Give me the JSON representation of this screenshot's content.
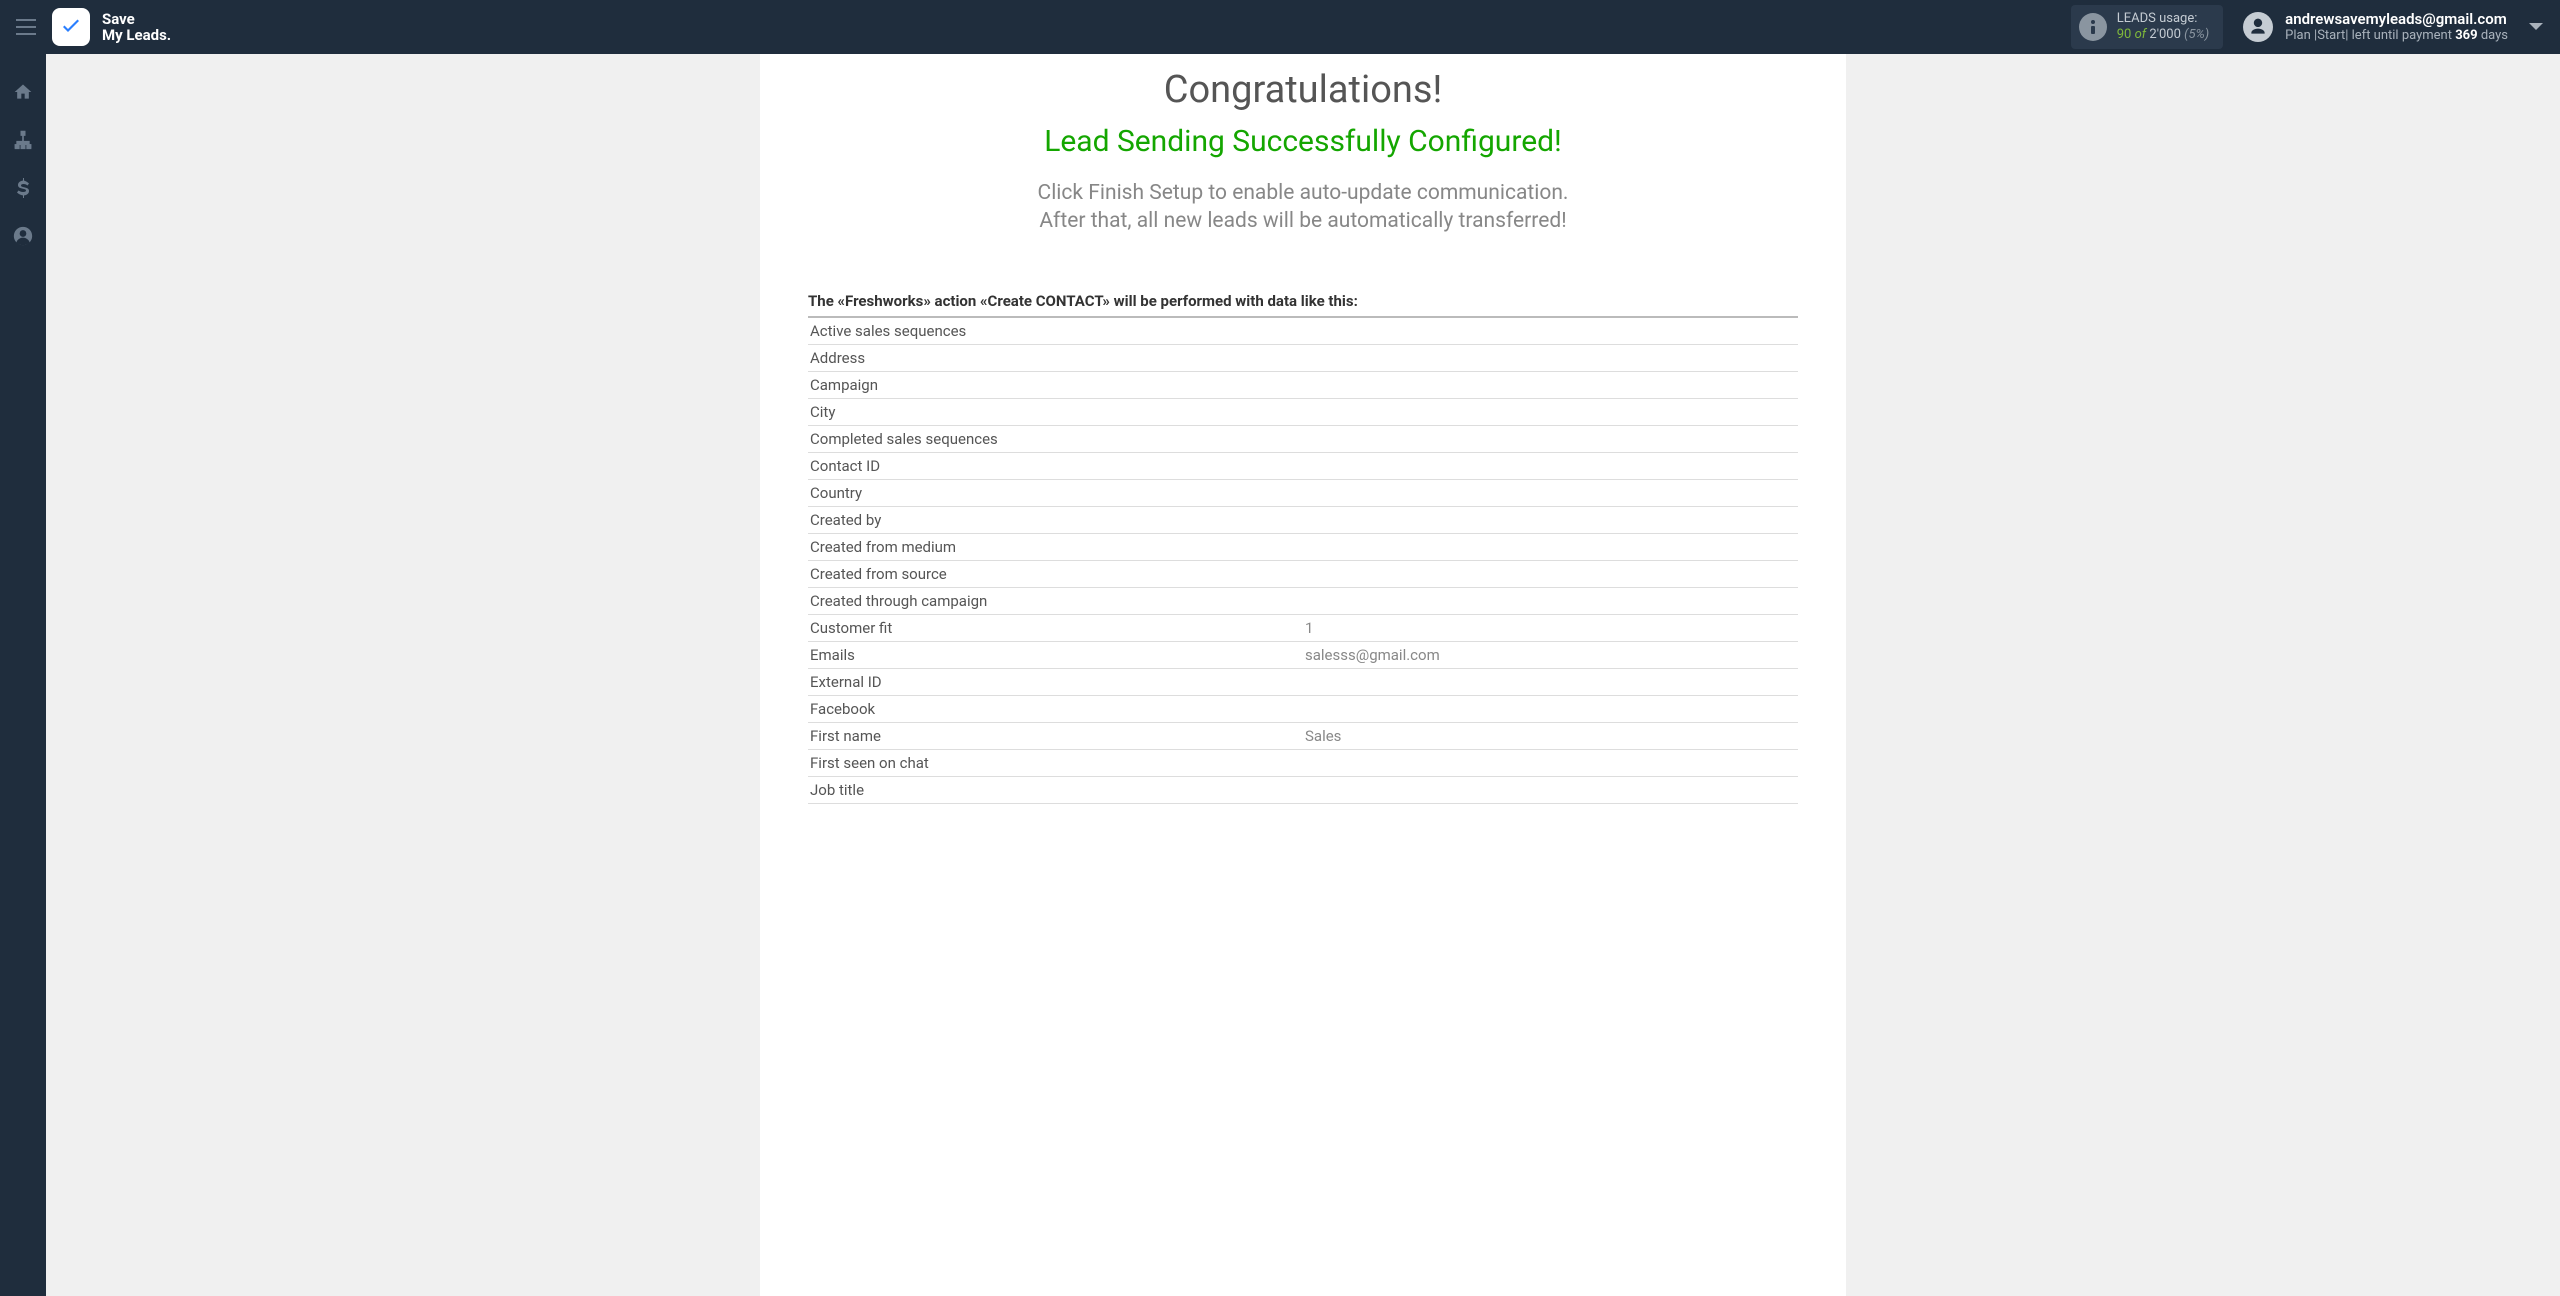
{
  "header": {
    "logo_line1": "Save",
    "logo_line2": "My Leads.",
    "usage": {
      "label": "LEADS usage:",
      "current": "90",
      "of": "of",
      "total": "2'000",
      "percent": "(5%)"
    },
    "account": {
      "email": "andrewsavemyleads@gmail.com",
      "plan_prefix": "Plan |",
      "plan_name": "Start",
      "plan_mid": "| left until payment ",
      "days_num": "369",
      "days_label": " days"
    }
  },
  "main": {
    "congrats": "Congratulations!",
    "success": "Lead Sending Successfully Configured!",
    "instructions_line1": "Click Finish Setup to enable auto-update communication.",
    "instructions_line2": "After that, all new leads will be automatically transferred!",
    "action_heading": "The «Freshworks» action «Create CONTACT» will be performed with data like this:",
    "rows": [
      {
        "label": "Active sales sequences",
        "value": ""
      },
      {
        "label": "Address",
        "value": ""
      },
      {
        "label": "Campaign",
        "value": ""
      },
      {
        "label": "City",
        "value": ""
      },
      {
        "label": "Completed sales sequences",
        "value": ""
      },
      {
        "label": "Contact ID",
        "value": ""
      },
      {
        "label": "Country",
        "value": ""
      },
      {
        "label": "Created by",
        "value": ""
      },
      {
        "label": "Created from medium",
        "value": ""
      },
      {
        "label": "Created from source",
        "value": ""
      },
      {
        "label": "Created through campaign",
        "value": ""
      },
      {
        "label": "Customer fit",
        "value": "1"
      },
      {
        "label": "Emails",
        "value": "salesss@gmail.com"
      },
      {
        "label": "External ID",
        "value": ""
      },
      {
        "label": "Facebook",
        "value": ""
      },
      {
        "label": "First name",
        "value": "Sales"
      },
      {
        "label": "First seen on chat",
        "value": ""
      },
      {
        "label": "Job title",
        "value": ""
      }
    ]
  }
}
